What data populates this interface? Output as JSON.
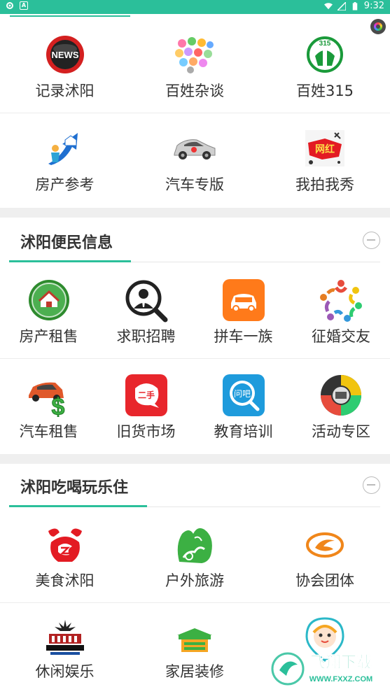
{
  "status_bar": {
    "left_icons": [
      "settings-icon",
      "a-icon"
    ],
    "a_label": "A",
    "right_icons": [
      "wifi-icon",
      "signal-icon",
      "battery-icon"
    ],
    "time": "9:32"
  },
  "top_section": {
    "rows": [
      [
        {
          "label": "记录沭阳",
          "icon": "news-icon"
        },
        {
          "label": "百姓杂谈",
          "icon": "chat-bubbles-icon"
        },
        {
          "label": "百姓315",
          "icon": "consumer-315-icon"
        }
      ],
      [
        {
          "label": "房产参考",
          "icon": "house-arrow-icon"
        },
        {
          "label": "汽车专版",
          "icon": "car-icon"
        },
        {
          "label": "我拍我秀",
          "icon": "wanghong-icon"
        }
      ]
    ]
  },
  "section_bianmin": {
    "title": "沭阳便民信息",
    "rows": [
      [
        {
          "label": "房产租售",
          "icon": "house-badge-icon"
        },
        {
          "label": "求职招聘",
          "icon": "person-search-icon"
        },
        {
          "label": "拼车一族",
          "icon": "carpool-icon"
        },
        {
          "label": "征婚交友",
          "icon": "people-circle-icon"
        }
      ],
      [
        {
          "label": "汽车租售",
          "icon": "car-dollar-icon"
        },
        {
          "label": "旧货市场",
          "icon": "secondhand-icon"
        },
        {
          "label": "教育培训",
          "icon": "wenba-icon"
        },
        {
          "label": "活动专区",
          "icon": "activity-icon"
        }
      ]
    ],
    "secondhand_text": "二手",
    "wenba_text": "问吧"
  },
  "section_chihe": {
    "title": "沭阳吃喝玩乐住",
    "rows": [
      [
        {
          "label": "美食沭阳",
          "icon": "food-icon"
        },
        {
          "label": "户外旅游",
          "icon": "outdoor-icon"
        },
        {
          "label": "协会团体",
          "icon": "association-icon"
        }
      ],
      [
        {
          "label": "休闲娱乐",
          "icon": "new-york-icon"
        },
        {
          "label": "家居装修",
          "icon": "home-decor-icon"
        },
        {
          "label": "",
          "icon": "baby-icon"
        }
      ]
    ]
  },
  "watermark": {
    "title": "飞翔下载",
    "url": "WWW.FXXZ.COM"
  },
  "colors": {
    "accent": "#2bbf9a",
    "text": "#333333",
    "gap": "#efefef"
  }
}
